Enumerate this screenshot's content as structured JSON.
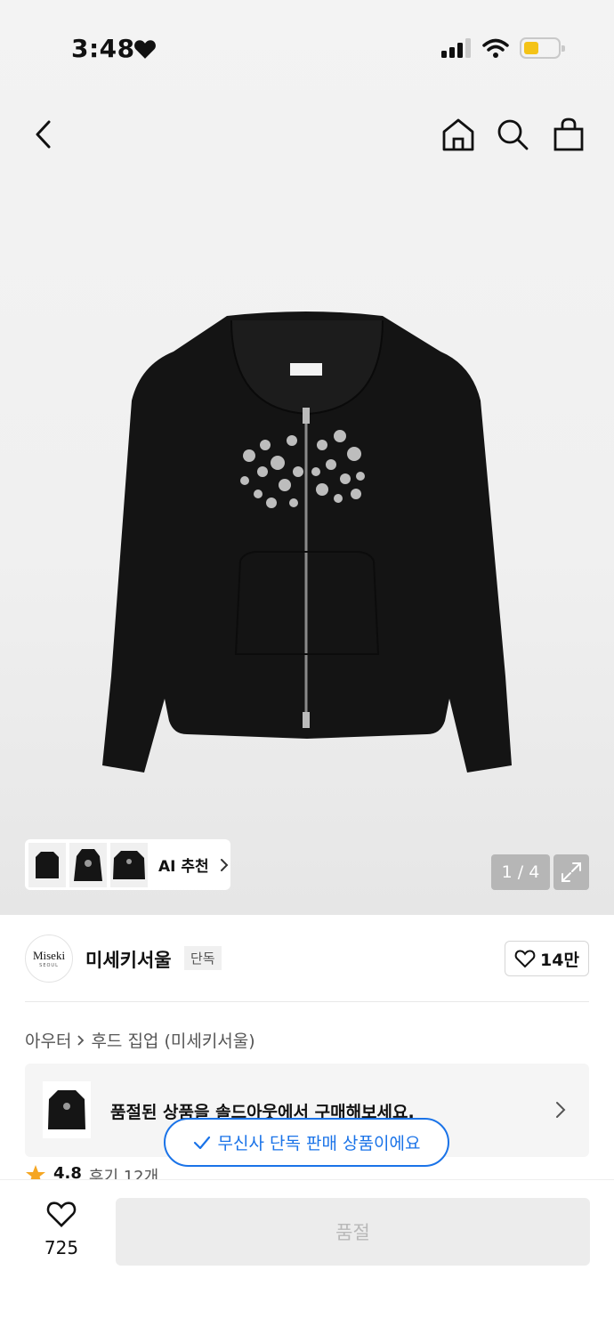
{
  "status": {
    "time": "3:48"
  },
  "nav": {
    "back": "chevron-left-icon",
    "home": "home-icon",
    "search": "search-icon",
    "cart": "shopping-bag-icon"
  },
  "gallery": {
    "ai_label": "AI 추천",
    "counter": "1 / 4"
  },
  "brand": {
    "logo_main": "Miseki",
    "logo_sub": "SEOUL",
    "name": "미세키서울",
    "badge": "단독",
    "likes": "14만"
  },
  "breadcrumb": {
    "category": "아우터",
    "sub": "후드 집업 (미세키서울)"
  },
  "soldout": {
    "message": "품절된 상품을 솔드아웃에서 구매해보세요."
  },
  "exclusive": {
    "label": "무신사 단독 판매 상품이에요"
  },
  "rating": {
    "score": "4.8",
    "reviews": "후기 12개"
  },
  "bottom": {
    "wish_count": "725",
    "buy_label": "품절"
  },
  "colors": {
    "accent_blue": "#1a73e8",
    "battery_yellow": "#f4c317",
    "star": "#f5a623"
  }
}
